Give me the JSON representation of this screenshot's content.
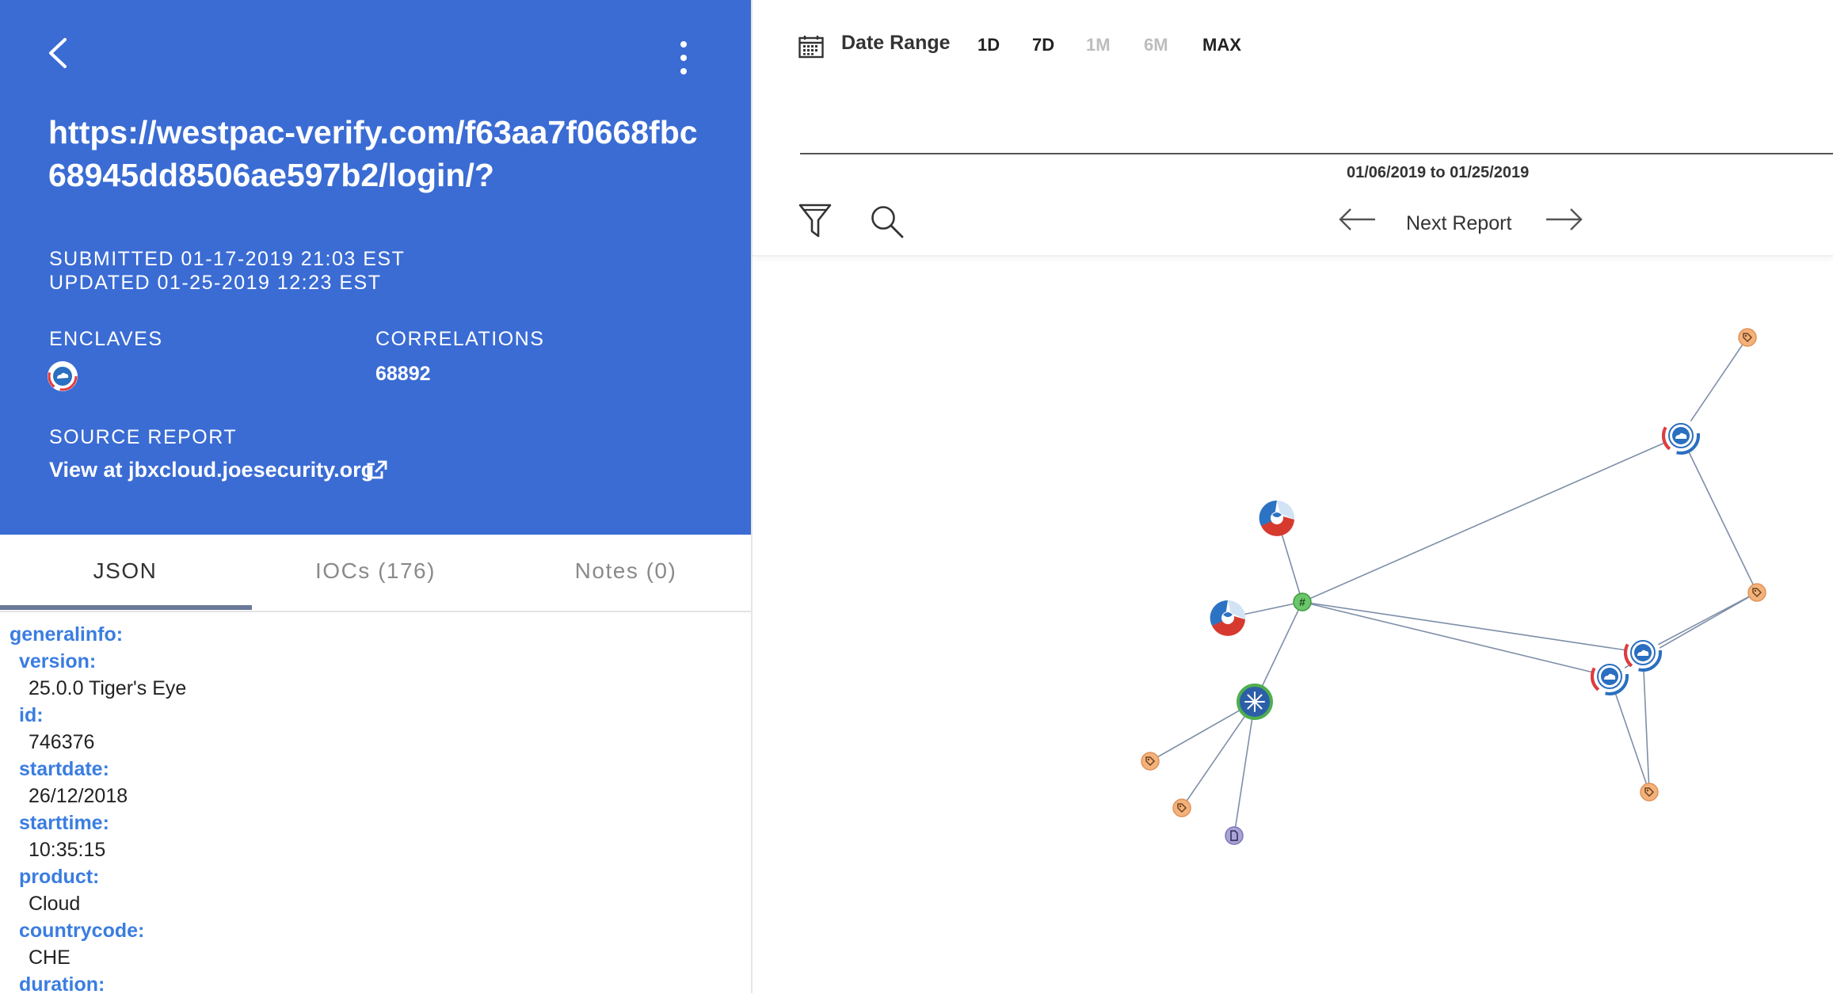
{
  "header": {
    "url": "https://westpac-verify.com/f63aa7f0668fbc68945dd8506ae597b2/login/?",
    "submitted": "SUBMITTED 01-17-2019 21:03 EST",
    "updated": "UPDATED 01-25-2019 12:23 EST",
    "enclaves_label": "ENCLAVES",
    "correlations_label": "CORRELATIONS",
    "correlations_value": "68892",
    "source_report_label": "SOURCE REPORT",
    "source_report_link": "View at jbxcloud.joesecurity.org"
  },
  "tabs": [
    {
      "label": "JSON",
      "active": true
    },
    {
      "label": "IOCs (176)",
      "active": false
    },
    {
      "label": "Notes (0)",
      "active": false
    }
  ],
  "json_view": {
    "root_key": "generalinfo:",
    "fields": [
      {
        "key": "version:",
        "value": "25.0.0 Tiger's Eye"
      },
      {
        "key": "id:",
        "value": "746376"
      },
      {
        "key": "startdate:",
        "value": "26/12/2018"
      },
      {
        "key": "starttime:",
        "value": "10:35:15"
      },
      {
        "key": "product:",
        "value": "Cloud"
      },
      {
        "key": "countrycode:",
        "value": "CHE"
      },
      {
        "key": "duration:",
        "value": ""
      }
    ]
  },
  "toolbar": {
    "date_range_label": "Date Range",
    "ranges": [
      {
        "label": "1D",
        "enabled": true
      },
      {
        "label": "7D",
        "enabled": true
      },
      {
        "label": "1M",
        "enabled": false
      },
      {
        "label": "6M",
        "enabled": false
      },
      {
        "label": "MAX",
        "enabled": true
      }
    ],
    "date_span_from": "01/06/2019",
    "date_span_to_word": "to",
    "date_span_to": "01/25/2019",
    "next_report_label": "Next Report"
  },
  "graph": {
    "hub_glyph": "#",
    "colors": {
      "header_bg": "#3b6cd4",
      "tag_node": "#f3b27a",
      "hub_node": "#6cc66c",
      "file_node": "#a9a3d6",
      "edge": "#7e8ea8"
    }
  }
}
